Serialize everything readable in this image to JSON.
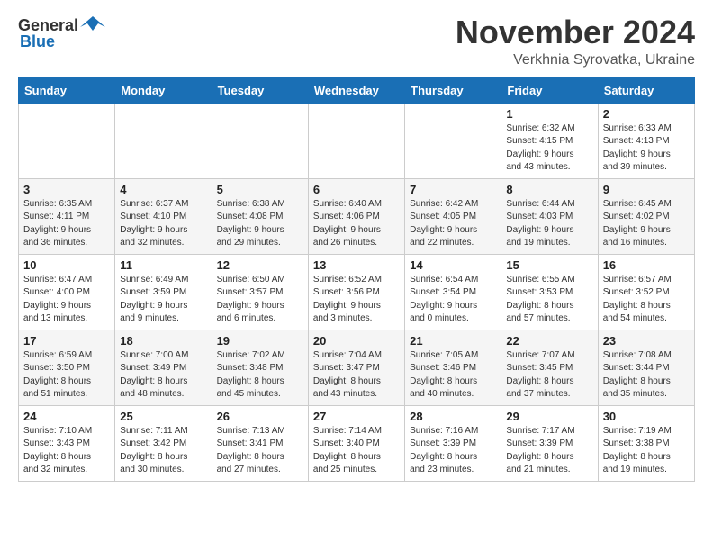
{
  "header": {
    "logo_general": "General",
    "logo_blue": "Blue",
    "month_title": "November 2024",
    "location": "Verkhnia Syrovatka, Ukraine"
  },
  "weekdays": [
    "Sunday",
    "Monday",
    "Tuesday",
    "Wednesday",
    "Thursday",
    "Friday",
    "Saturday"
  ],
  "weeks": [
    [
      {
        "day": "",
        "detail": ""
      },
      {
        "day": "",
        "detail": ""
      },
      {
        "day": "",
        "detail": ""
      },
      {
        "day": "",
        "detail": ""
      },
      {
        "day": "",
        "detail": ""
      },
      {
        "day": "1",
        "detail": "Sunrise: 6:32 AM\nSunset: 4:15 PM\nDaylight: 9 hours\nand 43 minutes."
      },
      {
        "day": "2",
        "detail": "Sunrise: 6:33 AM\nSunset: 4:13 PM\nDaylight: 9 hours\nand 39 minutes."
      }
    ],
    [
      {
        "day": "3",
        "detail": "Sunrise: 6:35 AM\nSunset: 4:11 PM\nDaylight: 9 hours\nand 36 minutes."
      },
      {
        "day": "4",
        "detail": "Sunrise: 6:37 AM\nSunset: 4:10 PM\nDaylight: 9 hours\nand 32 minutes."
      },
      {
        "day": "5",
        "detail": "Sunrise: 6:38 AM\nSunset: 4:08 PM\nDaylight: 9 hours\nand 29 minutes."
      },
      {
        "day": "6",
        "detail": "Sunrise: 6:40 AM\nSunset: 4:06 PM\nDaylight: 9 hours\nand 26 minutes."
      },
      {
        "day": "7",
        "detail": "Sunrise: 6:42 AM\nSunset: 4:05 PM\nDaylight: 9 hours\nand 22 minutes."
      },
      {
        "day": "8",
        "detail": "Sunrise: 6:44 AM\nSunset: 4:03 PM\nDaylight: 9 hours\nand 19 minutes."
      },
      {
        "day": "9",
        "detail": "Sunrise: 6:45 AM\nSunset: 4:02 PM\nDaylight: 9 hours\nand 16 minutes."
      }
    ],
    [
      {
        "day": "10",
        "detail": "Sunrise: 6:47 AM\nSunset: 4:00 PM\nDaylight: 9 hours\nand 13 minutes."
      },
      {
        "day": "11",
        "detail": "Sunrise: 6:49 AM\nSunset: 3:59 PM\nDaylight: 9 hours\nand 9 minutes."
      },
      {
        "day": "12",
        "detail": "Sunrise: 6:50 AM\nSunset: 3:57 PM\nDaylight: 9 hours\nand 6 minutes."
      },
      {
        "day": "13",
        "detail": "Sunrise: 6:52 AM\nSunset: 3:56 PM\nDaylight: 9 hours\nand 3 minutes."
      },
      {
        "day": "14",
        "detail": "Sunrise: 6:54 AM\nSunset: 3:54 PM\nDaylight: 9 hours\nand 0 minutes."
      },
      {
        "day": "15",
        "detail": "Sunrise: 6:55 AM\nSunset: 3:53 PM\nDaylight: 8 hours\nand 57 minutes."
      },
      {
        "day": "16",
        "detail": "Sunrise: 6:57 AM\nSunset: 3:52 PM\nDaylight: 8 hours\nand 54 minutes."
      }
    ],
    [
      {
        "day": "17",
        "detail": "Sunrise: 6:59 AM\nSunset: 3:50 PM\nDaylight: 8 hours\nand 51 minutes."
      },
      {
        "day": "18",
        "detail": "Sunrise: 7:00 AM\nSunset: 3:49 PM\nDaylight: 8 hours\nand 48 minutes."
      },
      {
        "day": "19",
        "detail": "Sunrise: 7:02 AM\nSunset: 3:48 PM\nDaylight: 8 hours\nand 45 minutes."
      },
      {
        "day": "20",
        "detail": "Sunrise: 7:04 AM\nSunset: 3:47 PM\nDaylight: 8 hours\nand 43 minutes."
      },
      {
        "day": "21",
        "detail": "Sunrise: 7:05 AM\nSunset: 3:46 PM\nDaylight: 8 hours\nand 40 minutes."
      },
      {
        "day": "22",
        "detail": "Sunrise: 7:07 AM\nSunset: 3:45 PM\nDaylight: 8 hours\nand 37 minutes."
      },
      {
        "day": "23",
        "detail": "Sunrise: 7:08 AM\nSunset: 3:44 PM\nDaylight: 8 hours\nand 35 minutes."
      }
    ],
    [
      {
        "day": "24",
        "detail": "Sunrise: 7:10 AM\nSunset: 3:43 PM\nDaylight: 8 hours\nand 32 minutes."
      },
      {
        "day": "25",
        "detail": "Sunrise: 7:11 AM\nSunset: 3:42 PM\nDaylight: 8 hours\nand 30 minutes."
      },
      {
        "day": "26",
        "detail": "Sunrise: 7:13 AM\nSunset: 3:41 PM\nDaylight: 8 hours\nand 27 minutes."
      },
      {
        "day": "27",
        "detail": "Sunrise: 7:14 AM\nSunset: 3:40 PM\nDaylight: 8 hours\nand 25 minutes."
      },
      {
        "day": "28",
        "detail": "Sunrise: 7:16 AM\nSunset: 3:39 PM\nDaylight: 8 hours\nand 23 minutes."
      },
      {
        "day": "29",
        "detail": "Sunrise: 7:17 AM\nSunset: 3:39 PM\nDaylight: 8 hours\nand 21 minutes."
      },
      {
        "day": "30",
        "detail": "Sunrise: 7:19 AM\nSunset: 3:38 PM\nDaylight: 8 hours\nand 19 minutes."
      }
    ]
  ]
}
